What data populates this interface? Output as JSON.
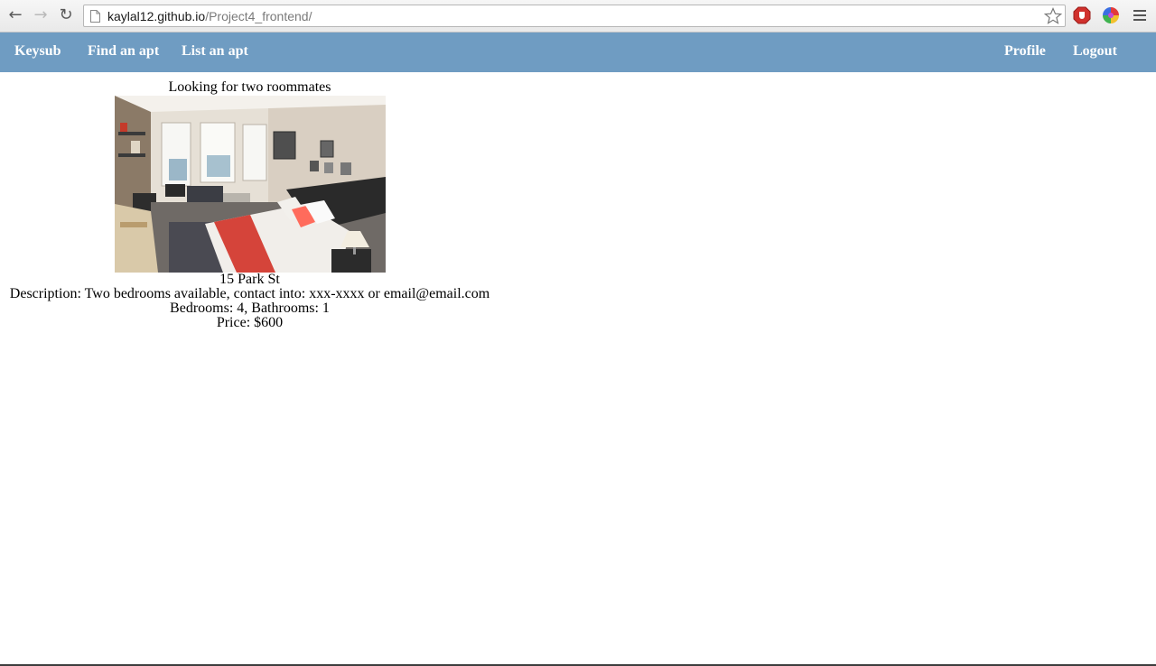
{
  "browser": {
    "url_host": "kaylal12.github.io",
    "url_path": "/Project4_frontend/",
    "back_icon": "arrow-left",
    "forward_icon": "arrow-right",
    "reload_icon": "reload",
    "star_icon": "bookmark-star",
    "extension_icons": [
      "adblock-stop-sign",
      "color-wheel"
    ]
  },
  "navbar": {
    "brand": "Keysub",
    "find": "Find an apt",
    "list": "List an apt",
    "profile": "Profile",
    "logout": "Logout",
    "bg_color": "#6f9cc2"
  },
  "listing": {
    "title": "Looking for two roommates",
    "address": "15 Park St",
    "description": "Description: Two bedrooms available, contact into: xxx-xxxx or email@email.com",
    "rooms": "Bedrooms: 4, Bathrooms: 1",
    "price": "Price: $600",
    "photo_icon": "bedroom-photo"
  }
}
